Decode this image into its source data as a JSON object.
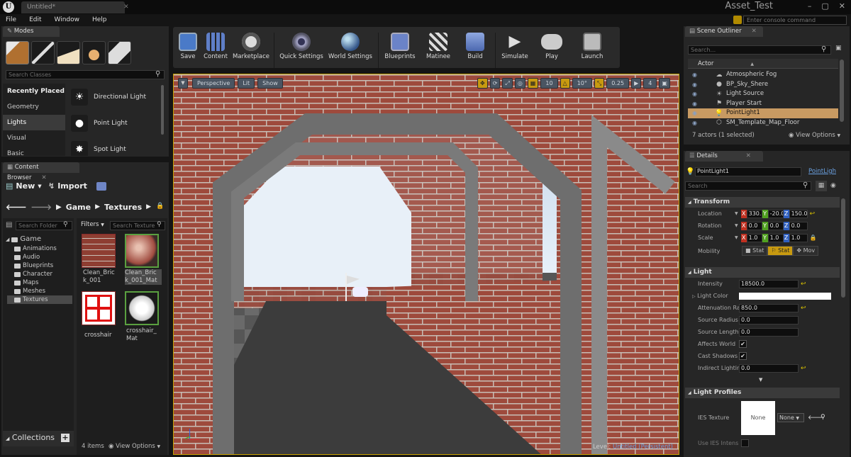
{
  "window": {
    "doc_tab": "Untitled*",
    "project": "Asset_Test",
    "controls": [
      "–",
      "▢",
      "✕"
    ]
  },
  "menu": [
    "File",
    "Edit",
    "Window",
    "Help"
  ],
  "console": {
    "placeholder": "Enter console command"
  },
  "modes": {
    "tab": "Modes",
    "search_placeholder": "Search Classes",
    "categories": [
      "Recently Placed",
      "Geometry",
      "Lights",
      "Visual",
      "Basic"
    ],
    "selected_category": "Lights",
    "items": [
      "Directional Light",
      "Point Light",
      "Spot Light"
    ]
  },
  "content_browser": {
    "tab": "Content Browser",
    "new_label": "New",
    "import_label": "Import",
    "path": [
      "Game",
      "Textures"
    ],
    "search_folders_placeholder": "Search Folder",
    "filters_label": "Filters",
    "search_textures_placeholder": "Search Texture",
    "tree_root": "Game",
    "tree": [
      "Animations",
      "Audio",
      "Blueprints",
      "Character",
      "Maps",
      "Meshes",
      "Textures"
    ],
    "selected_folder": "Textures",
    "assets": [
      "Clean_Brick_001",
      "Clean_Brick_001_Mat",
      "crosshair",
      "crosshair_Mat"
    ],
    "asset_lines": [
      [
        "Clean_Bric",
        "k_001"
      ],
      [
        "Clean_Bric",
        "k_001_Mat"
      ],
      [
        "crosshair"
      ],
      [
        "crosshair_",
        "Mat"
      ]
    ],
    "item_count": "4 items",
    "view_options": "View Options",
    "collections": "Collections"
  },
  "toolbar": [
    "Save",
    "Content",
    "Marketplace",
    "Quick Settings",
    "World Settings",
    "Blueprints",
    "Matinee",
    "Build",
    "Simulate",
    "Play",
    "Launch"
  ],
  "viewport": {
    "perspective": "Perspective",
    "lit": "Lit",
    "show": "Show",
    "grid_snap": "10",
    "rot_snap": "10°",
    "scale_snap": "0.25",
    "cam_speed": "4",
    "level_label": "Level:",
    "level_name": "Untitled (Persistent)"
  },
  "outliner": {
    "tab": "Scene Outliner",
    "search_placeholder": "Search...",
    "column": "Actor",
    "actors": [
      "Atmospheric Fog",
      "BP_Sky_Shere",
      "Light Source",
      "Player Start",
      "PointLight1",
      "SM_Template_Map_Floor"
    ],
    "selected": "PointLight1",
    "status": "7 actors (1 selected)",
    "view_options": "View Options"
  },
  "details": {
    "tab": "Details",
    "name": "PointLight1",
    "class_link": "PointLigh",
    "search_placeholder": "Search",
    "transform": {
      "title": "Transform",
      "location": {
        "label": "Location",
        "x": "330.0",
        "y": "-20.0",
        "z": "150.0"
      },
      "rotation": {
        "label": "Rotation",
        "x": "0.0",
        "y": "0.0",
        "z": "0.0"
      },
      "scale": {
        "label": "Scale",
        "x": "1.0",
        "y": "1.0",
        "z": "1.0"
      },
      "mobility": {
        "label": "Mobility",
        "options": [
          "Stat",
          "Stat",
          "Mov"
        ]
      }
    },
    "light": {
      "title": "Light",
      "intensity": {
        "label": "Intensity",
        "value": "18500.0"
      },
      "light_color": {
        "label": "Light Color"
      },
      "attenuation": {
        "label": "Attenuation Ra",
        "value": "850.0"
      },
      "source_radius": {
        "label": "Source Radius",
        "value": "0.0"
      },
      "source_length": {
        "label": "Source Length",
        "value": "0.0"
      },
      "affects_world": {
        "label": "Affects World"
      },
      "cast_shadows": {
        "label": "Cast Shadows"
      },
      "indirect": {
        "label": "Indirect Lightin",
        "value": "0.0"
      }
    },
    "profiles": {
      "title": "Light Profiles",
      "ies_label": "IES Texture",
      "ies_value": "None",
      "ies_dropdown": "None",
      "use_ies": "Use IES Intens"
    }
  }
}
